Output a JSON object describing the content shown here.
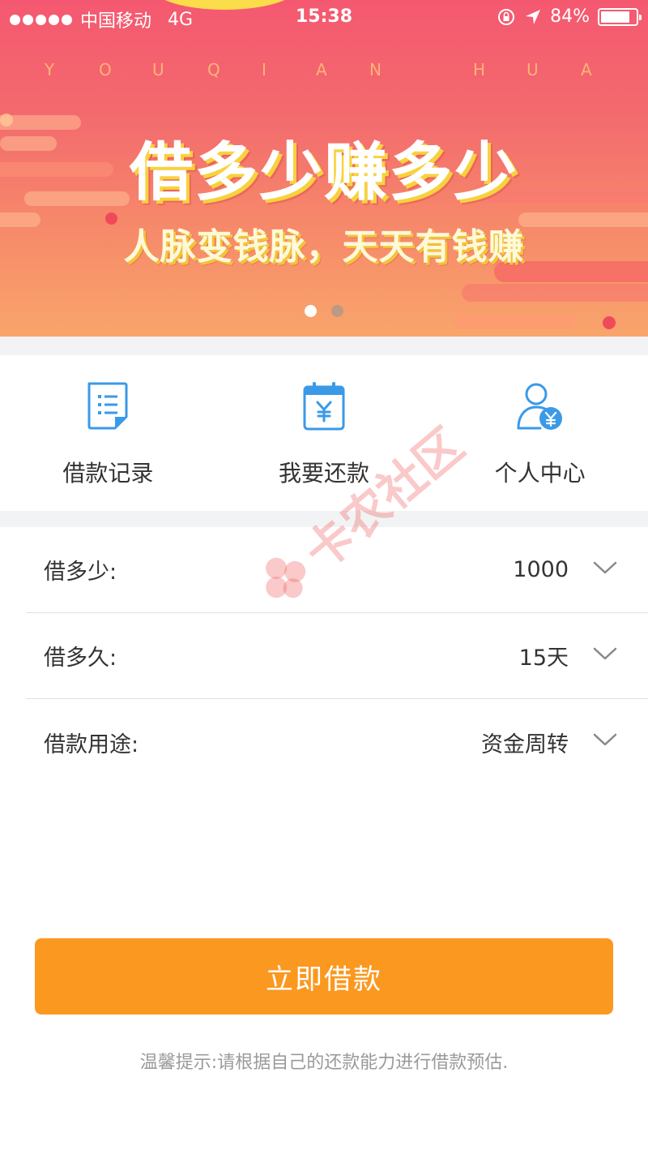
{
  "status_bar": {
    "carrier": "中国移动",
    "network": "4G",
    "time": "15:38",
    "battery": "84%",
    "battery_level": 0.84
  },
  "banner": {
    "brand_letters": [
      "Y",
      "O",
      "U",
      "Q",
      "I",
      "A",
      "N",
      "H",
      "U",
      "A"
    ],
    "headline": "借多少赚多少",
    "subline": "人脉变钱脉，天天有钱赚",
    "pager": {
      "total": 2,
      "active": 1
    }
  },
  "menu": {
    "items": [
      {
        "label": "借款记录",
        "icon": "document-list-icon"
      },
      {
        "label": "我要还款",
        "icon": "calendar-yen-icon"
      },
      {
        "label": "个人中心",
        "icon": "user-yen-icon"
      }
    ]
  },
  "form": {
    "amount": {
      "label": "借多少:",
      "value": "1000"
    },
    "term": {
      "label": "借多久:",
      "value": "15天"
    },
    "purpose": {
      "label": "借款用途:",
      "value": "资金周转"
    }
  },
  "submit_label": "立即借款",
  "tip": "温馨提示:请根据自己的还款能力进行借款预估.",
  "watermark": "卡农社区",
  "colors": {
    "accent": "#fb981f",
    "icon_blue": "#3a9ae8",
    "banner_top": "#f45870",
    "banner_bottom": "#f9a56b"
  }
}
